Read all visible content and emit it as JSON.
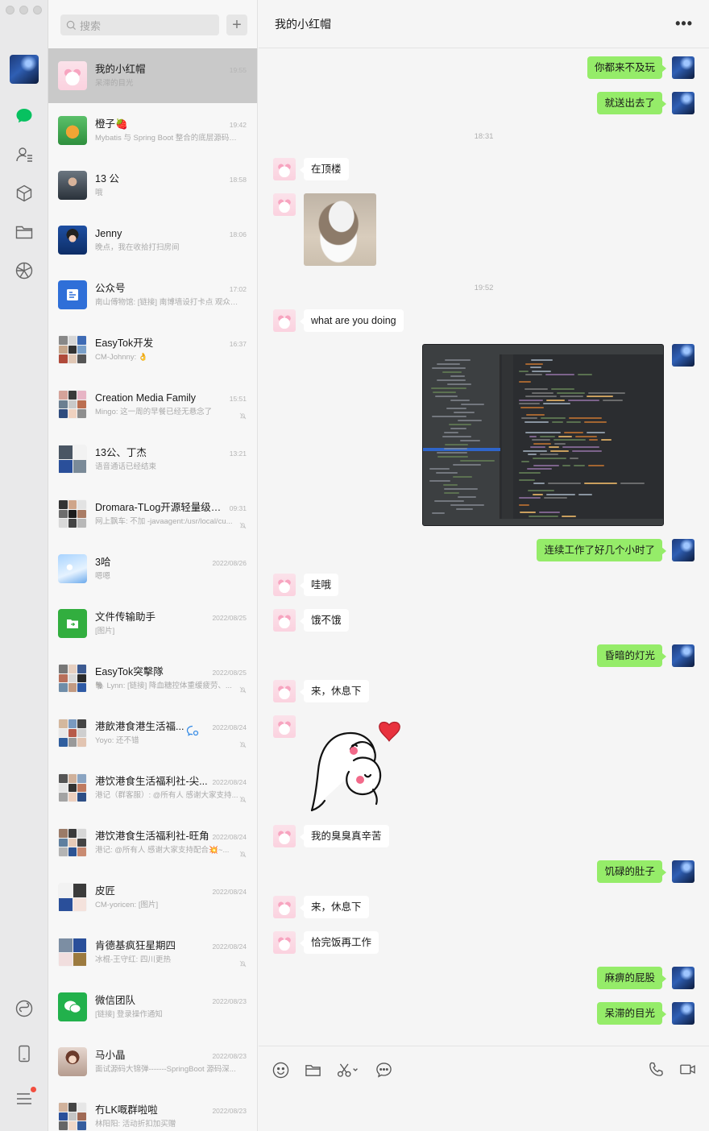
{
  "search": {
    "placeholder": "搜索"
  },
  "add_label": "+",
  "chats": [
    {
      "name": "我的小红帽",
      "preview": "呆滞的目光",
      "time": "19:55",
      "active": true,
      "muted": false
    },
    {
      "name": "橙子🍓",
      "preview": "Mybatis 与 Spring Boot 整合的底层源码分析",
      "time": "19:42",
      "muted": false
    },
    {
      "name": "13 公",
      "preview": "哦",
      "time": "18:58",
      "muted": false
    },
    {
      "name": "Jenny",
      "preview": "晚点，我在收拾打扫房间",
      "time": "18:06",
      "muted": false
    },
    {
      "name": "公众号",
      "preview": "南山傅物馆: [链接] 南博墙设打卡点 观众互...",
      "time": "17:02",
      "muted": false
    },
    {
      "name": "EasyTok开发",
      "preview": "CM-Johnny: 👌",
      "time": "16:37",
      "muted": false
    },
    {
      "name": "Creation Media Family",
      "preview": "Mingo: 这一周的早餐已经无悬念了",
      "time": "15:51",
      "muted": true
    },
    {
      "name": "13公、丁杰",
      "preview": "语音通话已经结束",
      "time": "13:21",
      "muted": false
    },
    {
      "name": "Dromara-TLog开源轻量级日...",
      "preview": "网上飘车: 不加 -javaagent:/usr/local/cu...",
      "time": "09:31",
      "muted": true
    },
    {
      "name": "3哈",
      "preview": "嗯嗯",
      "time": "2022/08/26",
      "muted": false
    },
    {
      "name": "文件传输助手",
      "preview": "[图片]",
      "time": "2022/08/25",
      "muted": false
    },
    {
      "name": "EasyTok突擊隊",
      "preview": "🐘 Lynn: [链接] 降血糖控体重缓疲劳、...",
      "time": "2022/08/25",
      "muted": true
    },
    {
      "name": "港飲港食港生活福...",
      "preview": "Yoyo: 还不错",
      "time": "2022/08/24",
      "muted": true
    },
    {
      "name": "港饮港食生活福利社-尖...",
      "preview": "港记（群客服）: @所有人 感谢大家支持...",
      "time": "2022/08/24",
      "muted": true
    },
    {
      "name": "港饮港食生活福利社-旺角",
      "preview": "港记: @所有人 感谢大家支持配合💥~...",
      "time": "2022/08/24",
      "muted": true
    },
    {
      "name": "皮匠",
      "preview": "CM-yoricen: [图片]",
      "time": "2022/08/24",
      "muted": false
    },
    {
      "name": "肯德基疯狂星期四",
      "preview": "冰棍-王守红: 四川更热",
      "time": "2022/08/24",
      "muted": true
    },
    {
      "name": "微信团队",
      "preview": "[链接] 登录操作通知",
      "time": "2022/08/23",
      "muted": false
    },
    {
      "name": "马小晶",
      "preview": "面试源码大锦弹-------SpringBoot 源码深...",
      "time": "2022/08/23",
      "muted": false
    },
    {
      "name": "冇LK嘅群啦啦",
      "preview": "林阳阳: 活动折扣加买赠",
      "time": "2022/08/23",
      "muted": false
    }
  ],
  "conversation": {
    "title": "我的小红帽",
    "more_label": "•••",
    "messages": [
      {
        "side": "right",
        "type": "text",
        "text": "你都来不及玩"
      },
      {
        "side": "right",
        "type": "text",
        "text": "就送出去了"
      },
      {
        "type": "time",
        "text": "18:31"
      },
      {
        "side": "left",
        "type": "text",
        "text": "在顶楼"
      },
      {
        "side": "left",
        "type": "image",
        "alt": "cat photo"
      },
      {
        "type": "time",
        "text": "19:52"
      },
      {
        "side": "left",
        "type": "text",
        "text": "what are you doing"
      },
      {
        "side": "right",
        "type": "image",
        "alt": "IDE screenshot"
      },
      {
        "side": "right",
        "type": "text",
        "text": "连续工作了好几个小时了"
      },
      {
        "side": "left",
        "type": "text",
        "text": "哇哦"
      },
      {
        "side": "left",
        "type": "text",
        "text": "饿不饿"
      },
      {
        "side": "right",
        "type": "text",
        "text": "昏暗的灯光"
      },
      {
        "side": "left",
        "type": "text",
        "text": "来，休息下"
      },
      {
        "side": "left",
        "type": "sticker",
        "alt": "hug sticker"
      },
      {
        "side": "left",
        "type": "text",
        "text": "我的臭臭真辛苦"
      },
      {
        "side": "right",
        "type": "text",
        "text": "饥碌的肚子"
      },
      {
        "side": "left",
        "type": "text",
        "text": "来，休息下"
      },
      {
        "side": "left",
        "type": "text",
        "text": "恰完饭再工作"
      },
      {
        "side": "right",
        "type": "text",
        "text": "麻痹的屁股"
      },
      {
        "side": "right",
        "type": "text",
        "text": "呆滞的目光"
      }
    ]
  },
  "colors": {
    "bubble_self": "#95ec69",
    "bubble_other": "#ffffff",
    "accent": "#07c160",
    "active_row": "#c9c9c9"
  }
}
